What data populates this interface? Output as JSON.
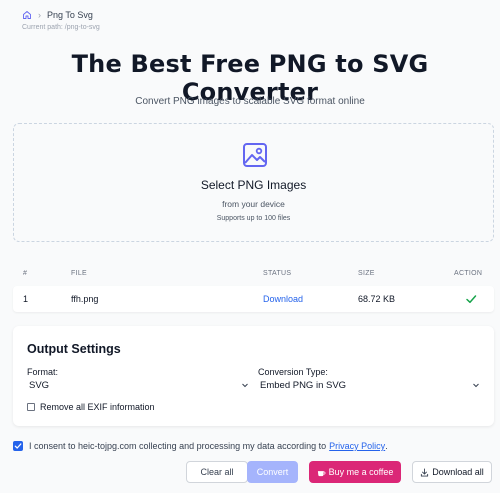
{
  "breadcrumb": {
    "current": "Png To Svg",
    "path_text": "Current path: /png-to-svg"
  },
  "header": {
    "title": "The Best Free PNG to SVG Converter",
    "subtitle": "Convert PNG images to scalable SVG format online"
  },
  "dropzone": {
    "heading": "Select PNG Images",
    "sub": "from your device",
    "note": "Supports up to 100 files"
  },
  "table": {
    "columns": [
      "#",
      "FILE",
      "STATUS",
      "SIZE",
      "ACTION"
    ],
    "rows": [
      {
        "index": "1",
        "file": "ffh.png",
        "status": "Download",
        "size": "68.72 KB"
      }
    ]
  },
  "settings": {
    "title": "Output Settings",
    "format_label": "Format:",
    "format_value": "SVG",
    "conversion_label": "Conversion Type:",
    "conversion_value": "Embed PNG in SVG",
    "exif_label": "Remove all EXIF information"
  },
  "consent": {
    "text": "I consent to heic-tojpg.com collecting and processing my data according to",
    "link": "Privacy Policy",
    "suffix": "."
  },
  "buttons": {
    "clear": "Clear all",
    "convert": "Convert",
    "coffee": "Buy me a coffee",
    "download_all": "Download all"
  },
  "colors": {
    "accent": "#2563eb",
    "convert_disabled": "#a5b4fc",
    "coffee": "#db2777",
    "success": "#16a34a",
    "icon": "#6366f1"
  },
  "icons": [
    "home-icon",
    "chevron-right-icon",
    "image-icon",
    "check-icon",
    "chevron-down-icon",
    "coffee-cup-icon",
    "download-icon"
  ]
}
